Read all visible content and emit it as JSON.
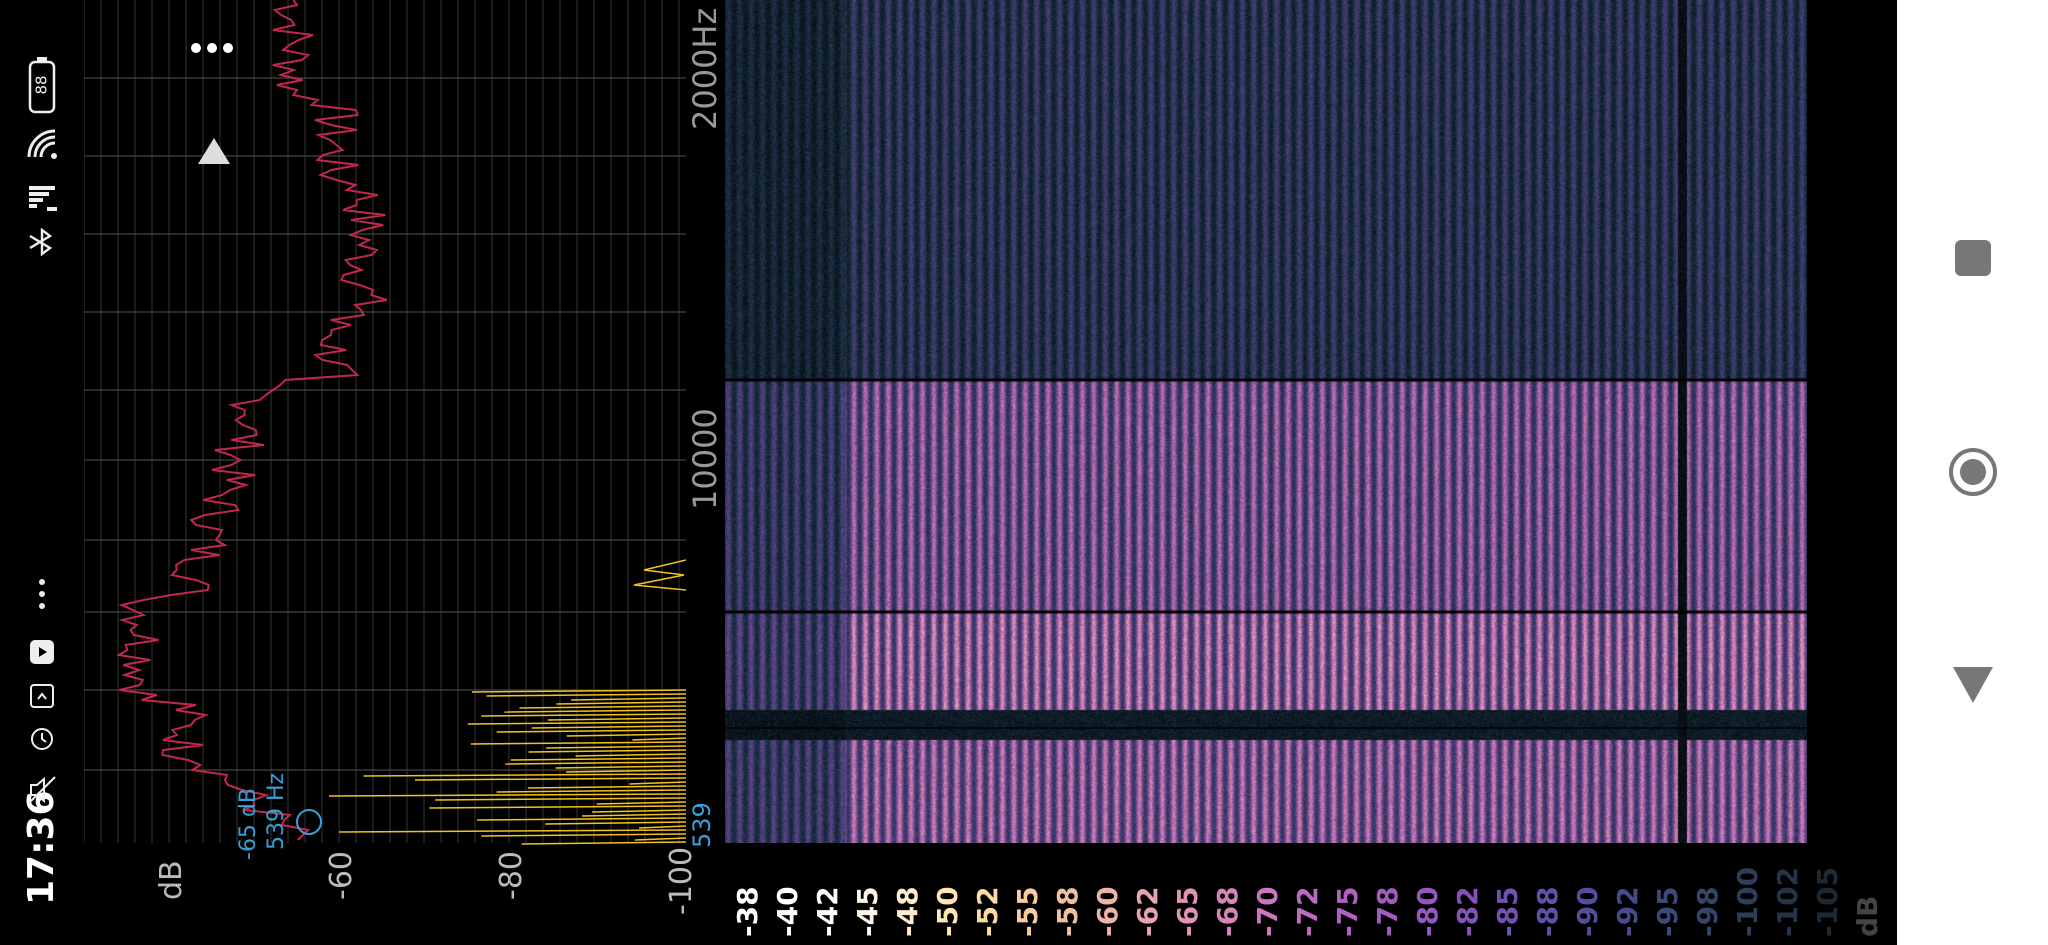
{
  "status_bar": {
    "time": "17:36",
    "battery_level": "88",
    "icons": [
      "mute-icon",
      "alarm-icon",
      "sim-icon",
      "youtube-icon",
      "more-notifications-icon",
      "bluetooth-icon",
      "signal-icon",
      "wifi-icon",
      "battery-icon"
    ]
  },
  "spectrum_plot": {
    "db_ticks": [
      "dB",
      "-60",
      "-80",
      "-100"
    ],
    "cursor_db": "-65 dB",
    "cursor_freq": "539 Hz",
    "line_colors": {
      "peak": "#c0294a",
      "live": "#f2c31f"
    }
  },
  "freq_axis": {
    "ticks": [
      "2000Hz",
      "10000",
      "539"
    ]
  },
  "colorbar": {
    "labels": [
      "-38",
      "-40",
      "-42",
      "-45",
      "-48",
      "-50",
      "-52",
      "-55",
      "-58",
      "-60",
      "-62",
      "-65",
      "-68",
      "-70",
      "-72",
      "-75",
      "-78",
      "-80",
      "-82",
      "-85",
      "-88",
      "-90",
      "-92",
      "-95",
      "-98",
      "-100",
      "-102",
      "-105",
      "dB"
    ]
  },
  "toolbar": {
    "menu_icon": "more-horiz-icon",
    "play_icon": "triangle-up-icon"
  },
  "nav_bar": {
    "buttons": [
      "recent-apps-icon",
      "home-icon",
      "back-icon"
    ]
  },
  "colors": {
    "background": "#000000",
    "spectrogram_low": "#0a1a20",
    "spectrogram_mid": "#7a4fa0",
    "spectrogram_high": "#f0b8c8",
    "cursor": "#3a9fd6"
  }
}
